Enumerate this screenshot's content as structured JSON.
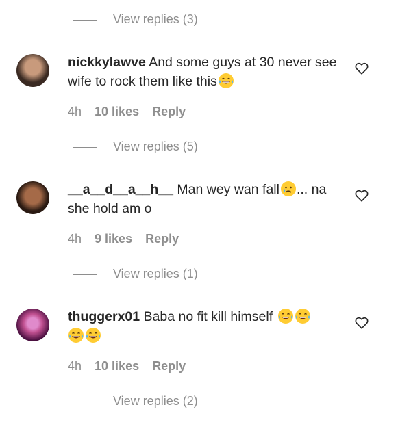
{
  "top_replies": {
    "label": "View replies (3)"
  },
  "comments": [
    {
      "username": "nickkylawve",
      "text": "And some guys at 30 never see wife to rock them like this",
      "emoji_after": [
        "laughing-tears-emoji"
      ],
      "time": "4h",
      "likes": "10 likes",
      "reply": "Reply",
      "replies": "View replies (5)",
      "avatar_colors": [
        "#3a2a22",
        "#c89a7c"
      ]
    },
    {
      "username": "__a__d__a__h__",
      "text": "Man wey wan fall",
      "emoji_mid": "crying-emoji",
      "text_after": "... na she hold am o",
      "time": "4h",
      "likes": "9 likes",
      "reply": "Reply",
      "replies": "View replies (1)",
      "avatar_colors": [
        "#2a1a12",
        "#a56a48"
      ]
    },
    {
      "username": "thuggerx01",
      "text": "Baba no fit kill himself",
      "emoji_after": [
        "laughing-tears-emoji",
        "laughing-tears-emoji",
        "laughing-tears-emoji",
        "laughing-tears-emoji"
      ],
      "time": "4h",
      "likes": "10 likes",
      "reply": "Reply",
      "replies": "View replies (2)",
      "avatar_colors": [
        "#4a1040",
        "#c05090"
      ]
    }
  ],
  "colors": {
    "text": "#262626",
    "muted": "#8e8e8e",
    "background": "#ffffff"
  }
}
